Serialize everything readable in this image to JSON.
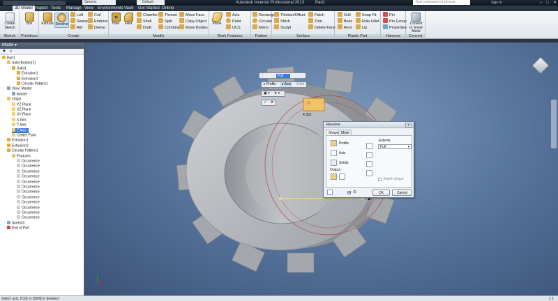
{
  "titlebar": {
    "app_title": "Autodesk Inventor Professional 2013",
    "doc_title": "Part1",
    "style_value": "Generic",
    "appearance_value": "Default",
    "search_placeholder": "Type a keyword or phrase",
    "signin": "Sign In"
  },
  "tabs": [
    "3D Model",
    "Inspect",
    "Tools",
    "Manage",
    "View",
    "Environments",
    "Vault",
    "Get Started",
    "Online"
  ],
  "ribbon": {
    "sketch": {
      "title": "Sketch",
      "create": "Create Sketch"
    },
    "primitives": {
      "title": "Primitives",
      "box": "Box"
    },
    "create": {
      "title": "Create",
      "extrude": "Extrude",
      "revolve": "Revolve",
      "loft": "Loft",
      "sweep": "Sweep",
      "rib": "Rib",
      "coil": "Coil",
      "emboss": "Emboss",
      "derive": "Derive"
    },
    "modify": {
      "title": "Modify",
      "hole": "Hole",
      "fillet": "Fillet",
      "chamfer": "Chamfer",
      "shell": "Shell",
      "draft": "Draft",
      "thread": "Thread",
      "split": "Split",
      "combine": "Combine",
      "move_face": "Move Face",
      "copy_object": "Copy Object",
      "move_bodies": "Move Bodies"
    },
    "work_features": {
      "title": "Work Features",
      "plane": "Plane",
      "axis": "Axis",
      "point": "Point",
      "ucs": "UCS"
    },
    "pattern": {
      "title": "Pattern",
      "rectangular": "Rectangular",
      "circular": "Circular",
      "mirror": "Mirror"
    },
    "surface": {
      "title": "Surface",
      "thicken": "Thicken/Offset",
      "stitch": "Stitch",
      "sculpt": "Sculpt",
      "patch": "Patch",
      "trim": "Trim",
      "delete_face": "Delete Face"
    },
    "plastic_part": {
      "title": "Plastic Part",
      "grill": "Grill",
      "boss": "Boss",
      "rest": "Rest",
      "snap_fit": "Snap Fit",
      "rule_fillet": "Rule Fillet",
      "lip": "Lip"
    },
    "harness": {
      "title": "Harness",
      "pin": "Pin",
      "pin_group": "Pin Group",
      "properties": "Properties"
    },
    "convert": {
      "title": "Convert",
      "sheet_metal": "Convert to Sheet Metal"
    }
  },
  "browser": {
    "header": "Model",
    "nodes": [
      {
        "label": "Part1",
        "level": 0,
        "icon": "part-icon",
        "color": "#e8b73a"
      },
      {
        "label": "Solid Bodies(1)",
        "level": 1,
        "icon": "folder-icon",
        "color": "#e8c25a"
      },
      {
        "label": "Solid1",
        "level": 2,
        "icon": "solid-icon",
        "color": "#d9b040"
      },
      {
        "label": "Extrusion1",
        "level": 3,
        "icon": "extrude-icon",
        "color": "#e2a840"
      },
      {
        "label": "Extrusion2",
        "level": 3,
        "icon": "extrude-icon",
        "color": "#e2a840"
      },
      {
        "label": "Circular Pattern1",
        "level": 3,
        "icon": "pattern-icon",
        "color": "#e2a840"
      },
      {
        "label": "View: Master",
        "level": 1,
        "icon": "view-icon",
        "color": "#8aa0b8"
      },
      {
        "label": "Master",
        "level": 2,
        "icon": "check-icon",
        "color": "#8aa0b8"
      },
      {
        "label": "Origin",
        "level": 1,
        "icon": "folder-icon",
        "color": "#e8c25a"
      },
      {
        "label": "YZ Plane",
        "level": 2,
        "icon": "plane-icon",
        "color": "#f0d070"
      },
      {
        "label": "XZ Plane",
        "level": 2,
        "icon": "plane-icon",
        "color": "#f0d070"
      },
      {
        "label": "XY Plane",
        "level": 2,
        "icon": "plane-icon",
        "color": "#f0d070"
      },
      {
        "label": "X Axis",
        "level": 2,
        "icon": "axis-icon",
        "color": "#f0d070"
      },
      {
        "label": "Y Axis",
        "level": 2,
        "icon": "axis-icon",
        "color": "#f0d070"
      },
      {
        "label": "Z Axis",
        "level": 2,
        "icon": "axis-icon",
        "color": "#f0d070",
        "selected": true
      },
      {
        "label": "Center Point",
        "level": 2,
        "icon": "point-icon",
        "color": "#f0d070"
      },
      {
        "label": "Extrusion1",
        "level": 1,
        "icon": "extrude-icon",
        "color": "#e2a840"
      },
      {
        "label": "Extrusion2",
        "level": 1,
        "icon": "extrude-icon",
        "color": "#e2a840"
      },
      {
        "label": "Circular Pattern1",
        "level": 1,
        "icon": "pattern-icon",
        "color": "#e2a840"
      },
      {
        "label": "Features",
        "level": 2,
        "icon": "folder-icon",
        "color": "#e8c25a"
      },
      {
        "label": "Occurrence",
        "level": 3,
        "icon": "occurrence-icon",
        "color": "#c8ced6"
      },
      {
        "label": "Occurrence",
        "level": 3,
        "icon": "occurrence-icon",
        "color": "#c8ced6"
      },
      {
        "label": "Occurrence",
        "level": 3,
        "icon": "occurrence-icon",
        "color": "#c8ced6"
      },
      {
        "label": "Occurrence",
        "level": 3,
        "icon": "occurrence-icon",
        "color": "#c8ced6"
      },
      {
        "label": "Occurrence",
        "level": 3,
        "icon": "occurrence-icon",
        "color": "#c8ced6"
      },
      {
        "label": "Occurrence",
        "level": 3,
        "icon": "occurrence-icon",
        "color": "#c8ced6"
      },
      {
        "label": "Occurrence",
        "level": 3,
        "icon": "occurrence-icon",
        "color": "#c8ced6"
      },
      {
        "label": "Occurrence",
        "level": 3,
        "icon": "occurrence-icon",
        "color": "#c8ced6"
      },
      {
        "label": "Occurrence",
        "level": 3,
        "icon": "occurrence-icon",
        "color": "#c8ced6"
      },
      {
        "label": "Occurrence",
        "level": 3,
        "icon": "occurrence-icon",
        "color": "#c8ced6"
      },
      {
        "label": "Occurrence",
        "level": 3,
        "icon": "occurrence-icon",
        "color": "#c8ced6"
      },
      {
        "label": "Occurrence",
        "level": 3,
        "icon": "occurrence-icon",
        "color": "#c8ced6"
      },
      {
        "label": "Sketch3",
        "level": 1,
        "icon": "sketch-icon",
        "color": "#7aa7d8"
      },
      {
        "label": "End of Part",
        "level": 1,
        "icon": "end-icon",
        "color": "#d04040"
      }
    ]
  },
  "revolve": {
    "title": "Revolve",
    "tab_shape": "Shape",
    "tab_more": "More",
    "profile": "Profile",
    "axis": "Axis",
    "solids": "Solids",
    "output": "Output",
    "extents": "Extents",
    "extents_value": "Full",
    "match_shape": "Match shape",
    "ok": "OK",
    "cancel": "Cancel"
  },
  "minitoolbar": {
    "value": "Full",
    "profile": "Profile",
    "axis": "Axis",
    "solid": "Solid"
  },
  "dimension": "4.352",
  "status": {
    "hint": "Select axis. [Ctrl] or [Shift] to deselect",
    "counts": "1    1"
  },
  "colors": {
    "accent": "#3b7bd8",
    "model_face": "#b5b7bb",
    "viewport": "#5a77a0"
  }
}
